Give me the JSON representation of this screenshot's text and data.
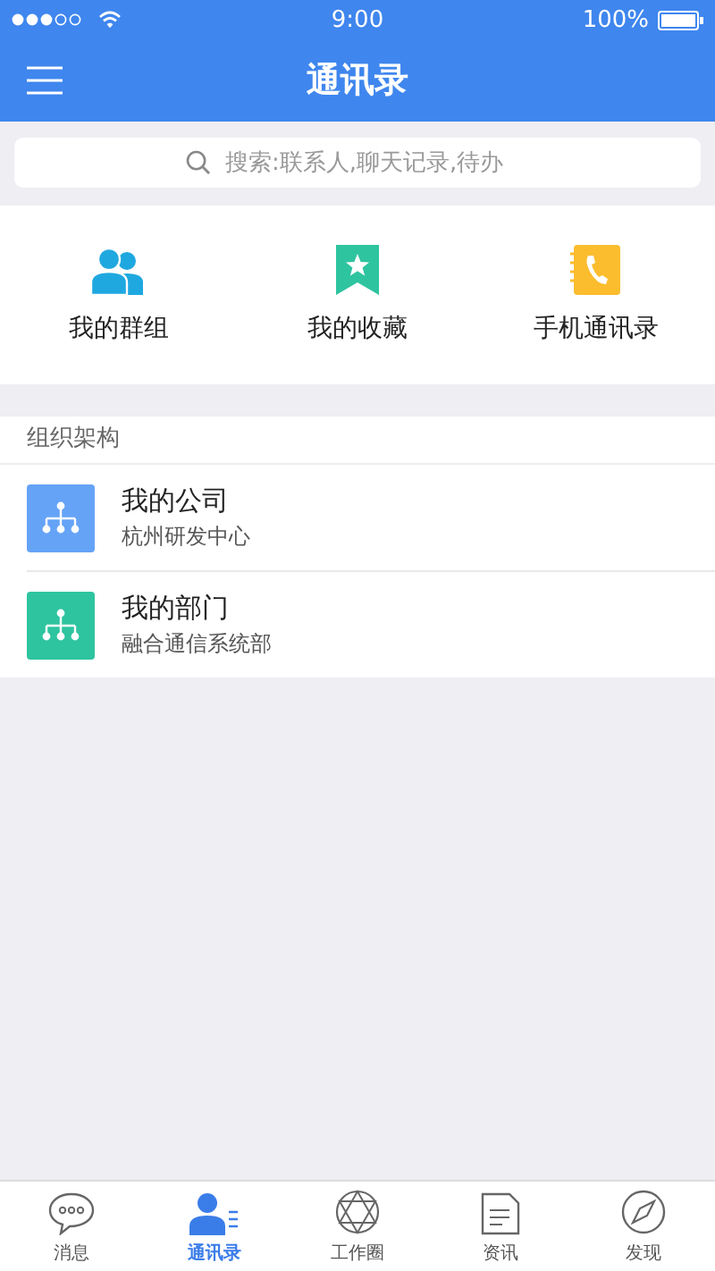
{
  "status_bar": {
    "time": "9:00",
    "battery": "100%"
  },
  "nav_bar": {
    "title": "通讯录"
  },
  "search": {
    "placeholder": "搜索:联系人,聊天记录,待办"
  },
  "shortcuts": [
    {
      "kind": "group",
      "label": "我的群组"
    },
    {
      "kind": "favorite",
      "label": "我的收藏"
    },
    {
      "kind": "phonebook",
      "label": "手机通讯录"
    }
  ],
  "org_section": {
    "title": "组织架构",
    "items": [
      {
        "title": "我的公司",
        "subtitle": "杭州研发中心",
        "color": "#65a3f7"
      },
      {
        "title": "我的部门",
        "subtitle": "融合通信系统部",
        "color": "#2ec4a0"
      }
    ]
  },
  "tab_bar": [
    {
      "kind": "chat",
      "label": "消息",
      "selected": false
    },
    {
      "kind": "contacts",
      "label": "通讯录",
      "selected": true
    },
    {
      "kind": "circle",
      "label": "工作圈",
      "selected": false
    },
    {
      "kind": "news",
      "label": "资讯",
      "selected": false
    },
    {
      "kind": "discover",
      "label": "发现",
      "selected": false
    }
  ]
}
